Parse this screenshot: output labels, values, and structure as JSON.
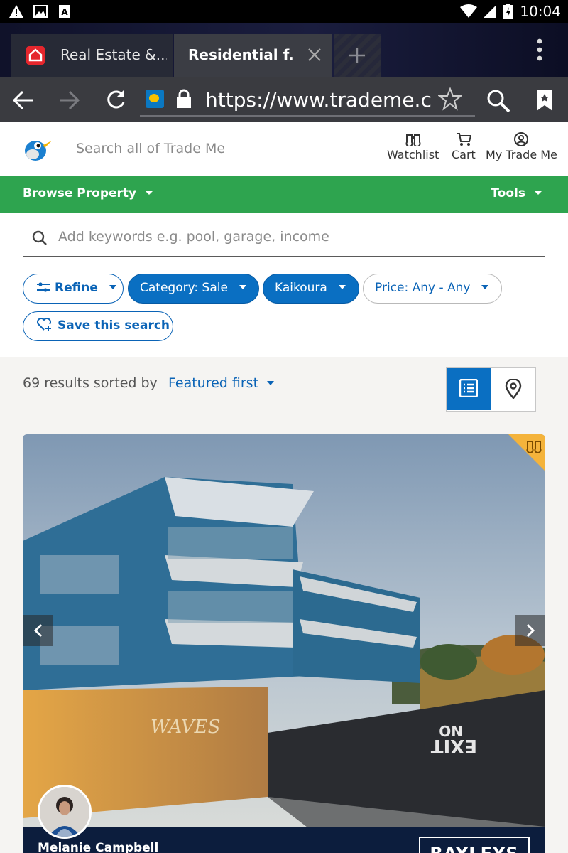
{
  "status_bar": {
    "time": "10:04"
  },
  "browser": {
    "tabs": [
      {
        "label": "Real Estate &..."
      },
      {
        "label": "Residential f..."
      }
    ],
    "url": "https://www.trademe.co.nz"
  },
  "site": {
    "search_placeholder": "Search all of Trade Me",
    "nav": {
      "watchlist": "Watchlist",
      "cart": "Cart",
      "my_trade_me": "My Trade Me"
    }
  },
  "green_bar": {
    "browse": "Browse Property",
    "tools": "Tools"
  },
  "filters": {
    "keyword_placeholder": "Add keywords e.g. pool, garage, income",
    "refine": "Refine",
    "category": "Category: Sale",
    "region": "Kaikoura",
    "price": "Price: Any - Any",
    "save_search": "Save this search"
  },
  "results": {
    "summary": "69 results sorted by",
    "sort": "Featured first"
  },
  "listing": {
    "agent_name": "Melanie Campbell",
    "agency": "BAYLEYS",
    "sign_text": "WAVES",
    "road_text": "EXIT\nNO"
  },
  "colors": {
    "green": "#2ea44f",
    "blue": "#0a6fc2",
    "gold": "#f4b33b",
    "navy": "#0c1d3d"
  }
}
